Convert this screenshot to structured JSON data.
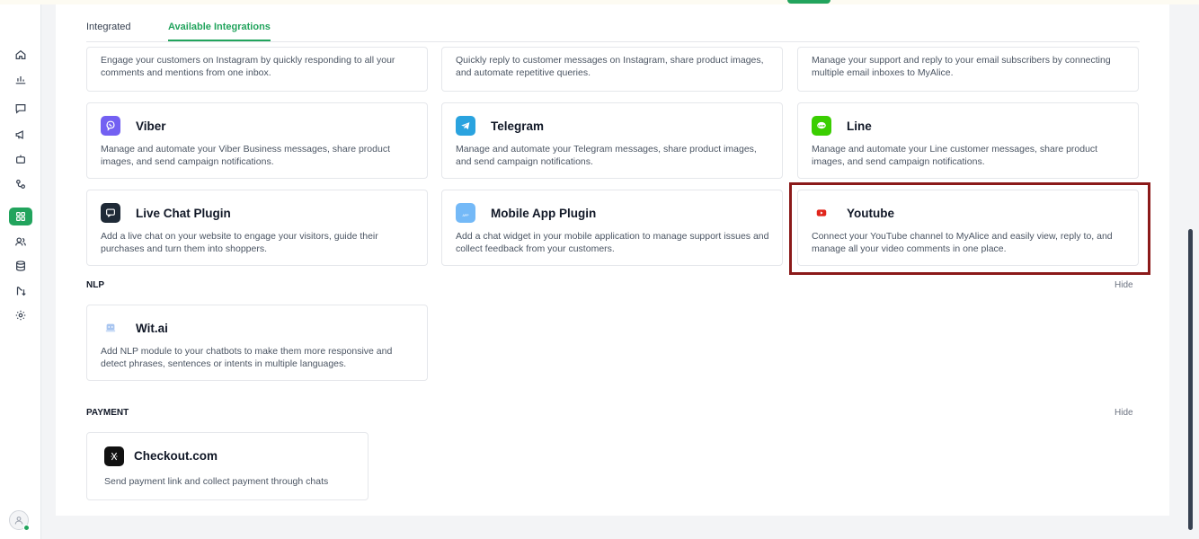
{
  "tabs": {
    "integrated": "Integrated",
    "available": "Available Integrations"
  },
  "top_cards": [
    {
      "desc": "Engage your customers on Instagram by quickly responding to all your comments and mentions from one inbox."
    },
    {
      "desc": "Quickly reply to customer messages on Instagram, share product images, and automate repetitive queries."
    },
    {
      "desc": "Manage your support and reply to your email subscribers by connecting multiple email inboxes to MyAlice."
    }
  ],
  "channel_cards": [
    {
      "title": "Viber",
      "desc": "Manage and automate your Viber Business messages, share product images, and send campaign notifications.",
      "icon": "viber-icon"
    },
    {
      "title": "Telegram",
      "desc": "Manage and automate your Telegram messages, share product images, and send campaign notifications.",
      "icon": "telegram-icon"
    },
    {
      "title": "Line",
      "desc": "Manage and automate your Line customer messages, share product images, and send campaign notifications.",
      "icon": "line-icon"
    },
    {
      "title": "Live Chat Plugin",
      "desc": "Add a live chat on your website to engage your visitors, guide their purchases and turn them into shoppers.",
      "icon": "live-chat-icon"
    },
    {
      "title": "Mobile App Plugin",
      "desc": "Add a chat widget in your mobile application to manage support issues and collect feedback from your customers.",
      "icon": "mobile-app-icon",
      "icon_text": "APP"
    },
    {
      "title": "Youtube",
      "desc": "Connect your YouTube channel to MyAlice and easily view, reply to, and manage all your video comments in one place.",
      "icon": "youtube-icon"
    }
  ],
  "nlp": {
    "label": "NLP",
    "hide": "Hide",
    "card": {
      "title": "Wit.ai",
      "desc": "Add NLP module to your chatbots to make them more responsive and detect phrases, sentences or intents in multiple languages.",
      "icon": "wit-ai-icon"
    }
  },
  "payment": {
    "label": "PAYMENT",
    "hide": "Hide",
    "card": {
      "title": "Checkout.com",
      "desc": "Send payment link and collect payment through chats",
      "icon": "checkout-icon"
    }
  },
  "sidebar_icons": [
    "home-icon",
    "analytics-icon",
    "inbox-icon",
    "broadcast-icon",
    "bot-icon",
    "workflow-icon",
    "integrations-icon",
    "customers-icon",
    "data-icon",
    "automation-icon",
    "settings-icon"
  ],
  "colors": {
    "accent": "#22a45d",
    "highlight_border": "#8b1a1a",
    "viber": "#7360f2",
    "telegram": "#2aa3df",
    "line": "#3ace01",
    "youtube": "#e1251b",
    "livechat": "#1f2a37",
    "mobileapp": "#74b9f7"
  }
}
